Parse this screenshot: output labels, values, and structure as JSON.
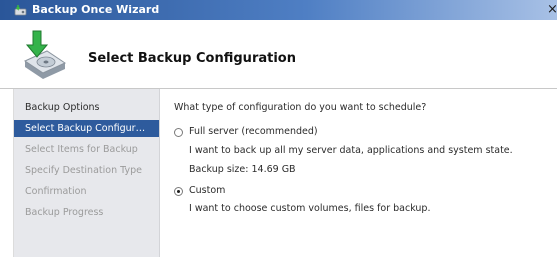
{
  "window": {
    "title": "Backup Once Wizard",
    "close_glyph": "×"
  },
  "header": {
    "title": "Select Backup Configuration",
    "icon": "backup-disk-arrow-icon"
  },
  "sidebar": {
    "items": [
      {
        "label": "Backup Options",
        "state": "done"
      },
      {
        "label": "Select Backup Configur…",
        "state": "active"
      },
      {
        "label": "Select Items for Backup",
        "state": "pending"
      },
      {
        "label": "Specify Destination Type",
        "state": "pending"
      },
      {
        "label": "Confirmation",
        "state": "pending"
      },
      {
        "label": "Backup Progress",
        "state": "pending"
      }
    ]
  },
  "main": {
    "question": "What type of configuration do you want to schedule?",
    "options": [
      {
        "label": "Full server (recommended)",
        "selected": false,
        "description": "I want to back up all my server data, applications and system state.",
        "size": "Backup size: 14.69 GB"
      },
      {
        "label": "Custom",
        "selected": true,
        "description": "I want to choose custom volumes, files for backup."
      }
    ]
  },
  "colors": {
    "titlebar_start": "#2a5699",
    "titlebar_end": "#a8c1e6",
    "sidebar_bg": "#e7e8ec",
    "sidebar_active": "#2e5b9d",
    "pending_text": "#9b9b9b"
  }
}
